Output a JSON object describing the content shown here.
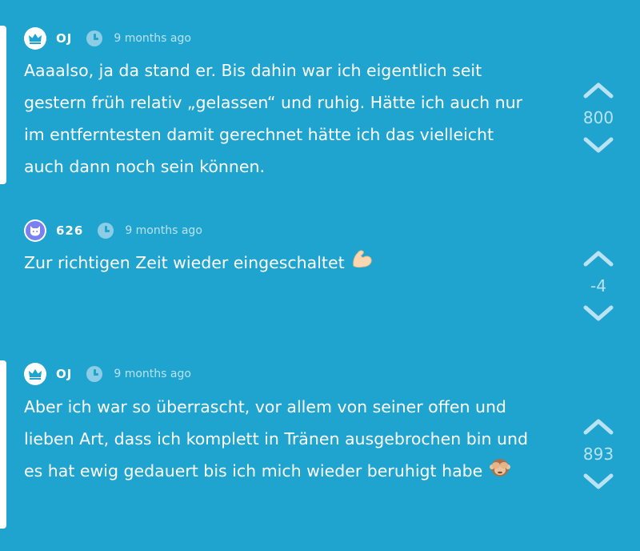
{
  "posts": [
    {
      "author": "OJ",
      "avatar_icon": "crown-icon",
      "time": "9 months ago",
      "text": "Aaaalso, ja da stand er. Bis dahin war ich eigentlich seit gestern früh relativ „gelassen“ und ruhig. Hätte ich auch nur im entferntesten damit gerechnet hätte ich das vielleicht auch dann noch sein können.",
      "votes": "800",
      "is_op": true
    },
    {
      "author": "626",
      "avatar_icon": "cat-icon",
      "time": "9 months ago",
      "text": "Zur richtigen Zeit wieder eingeschaltet",
      "emoji": "flexed-biceps-emoji",
      "votes": "-4",
      "is_op": false
    },
    {
      "author": "OJ",
      "avatar_icon": "crown-icon",
      "time": "9 months ago",
      "text": "Aber ich war so überrascht, vor allem von seiner offen und lieben Art, dass ich komplett in Tränen ausgebrochen bin und es hat ewig gedauert bis ich mich wieder beruhigt habe",
      "emoji": "see-no-evil-monkey-emoji",
      "votes": "893",
      "is_op": true
    }
  ],
  "colors": {
    "background": "#1fa3cf",
    "text": "#ffffff",
    "muted": "#b9e3f2",
    "icon": "#8ccde6"
  }
}
